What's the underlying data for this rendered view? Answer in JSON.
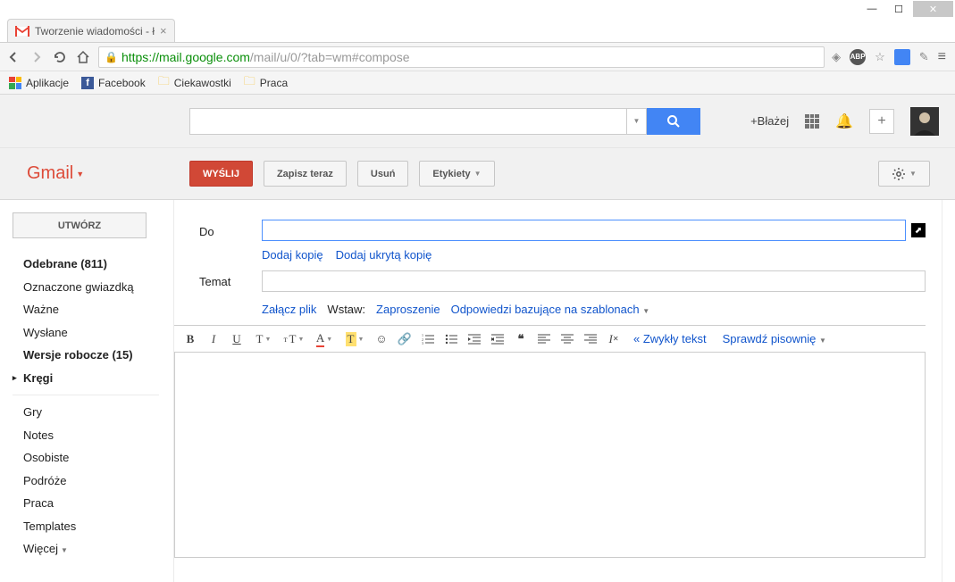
{
  "window": {
    "tab_title": "Tworzenie wiadomości - ł"
  },
  "nav": {
    "url_https": "https",
    "url_host": "://mail.google.com",
    "url_path": "/mail/u/0/?tab=wm#compose"
  },
  "bookmarks": {
    "apps": "Aplikacje",
    "facebook": "Facebook",
    "ciekawostki": "Ciekawostki",
    "praca": "Praca"
  },
  "gbar": {
    "user": "+Błażej"
  },
  "brand": "Gmail",
  "actions": {
    "send": "WYŚLIJ",
    "save_now": "Zapisz teraz",
    "discard": "Usuń",
    "labels": "Etykiety"
  },
  "sidebar": {
    "compose": "UTWÓRZ",
    "inbox": "Odebrane (811)",
    "starred": "Oznaczone gwiazdką",
    "important": "Ważne",
    "sent": "Wysłane",
    "drafts": "Wersje robocze (15)",
    "circles": "Kręgi",
    "gry": "Gry",
    "notes": "Notes",
    "osobiste": "Osobiste",
    "podroze": "Podróże",
    "praca": "Praca",
    "templates": "Templates",
    "more": "Więcej"
  },
  "compose": {
    "to_label": "Do",
    "subject_label": "Temat",
    "add_cc": "Dodaj kopię",
    "add_bcc": "Dodaj ukrytą kopię",
    "attach": "Załącz plik",
    "insert": "Wstaw:",
    "invitation": "Zaproszenie",
    "canned": "Odpowiedzi bazujące na szablonach",
    "plain_text": "« Zwykły tekst",
    "check_spelling": "Sprawdź pisownię"
  }
}
